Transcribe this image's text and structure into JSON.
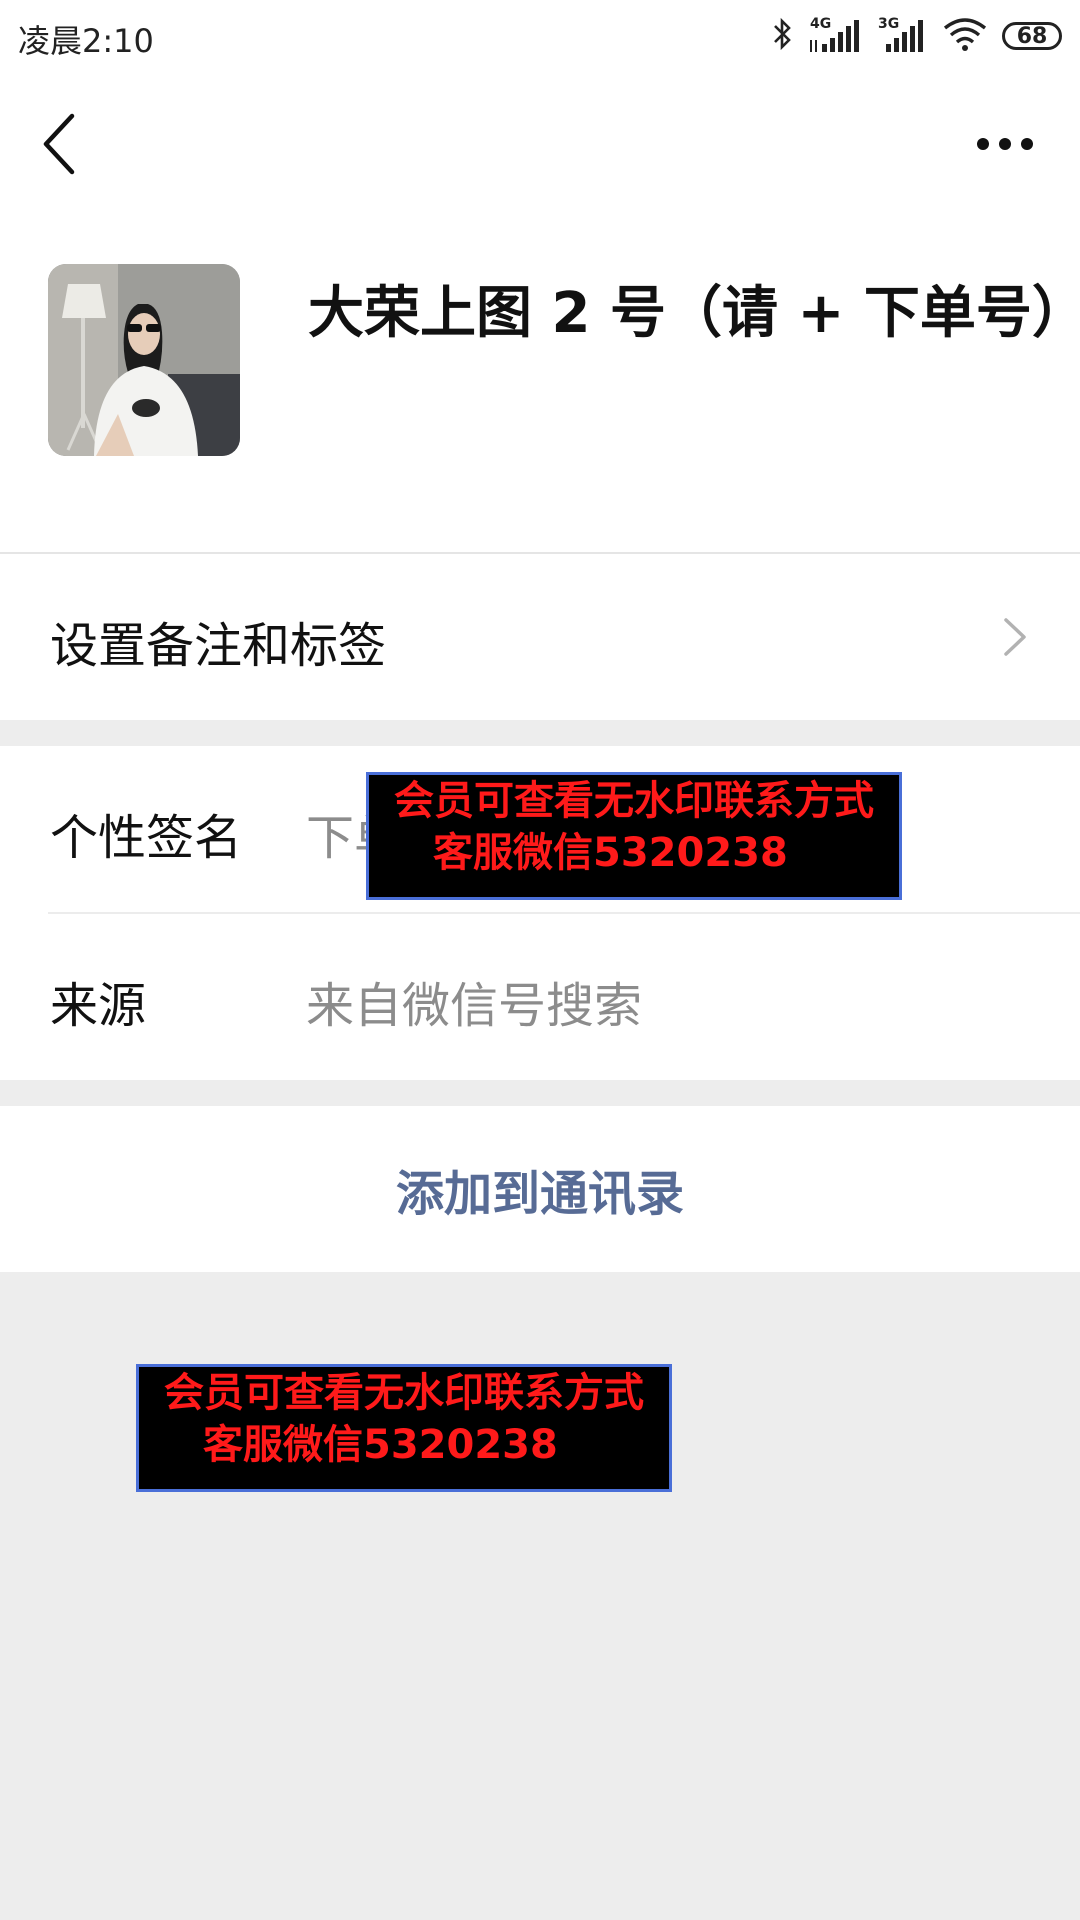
{
  "status_bar": {
    "time": "凌晨2:10",
    "network_1": "4G",
    "network_2": "3G",
    "battery": "68",
    "icons": [
      "bluetooth-icon",
      "signal-4g-icon",
      "signal-3g-icon",
      "wifi-icon",
      "battery-icon"
    ]
  },
  "nav": {
    "back_icon": "back-arrow-icon",
    "more_icon": "more-dots-icon"
  },
  "profile": {
    "name": "大荣上图 2 号（请 + 下单号）"
  },
  "remark_row": {
    "label": "设置备注和标签",
    "icon": "chevron-right-icon"
  },
  "info_rows": [
    {
      "label": "个性签名",
      "value": "下单"
    },
    {
      "label": "来源",
      "value": "来自微信号搜索"
    }
  ],
  "add_button": {
    "label": "添加到通讯录"
  },
  "watermarks": [
    {
      "line1": "会员可查看无水印联系方式",
      "line2": "客服微信5320238"
    },
    {
      "line1": "会员可查看无水印联系方式",
      "line2": "客服微信5320238"
    }
  ],
  "colors": {
    "link_blue": "#576b95",
    "watermark_text": "#ff1a1a",
    "background": "#ededed"
  }
}
